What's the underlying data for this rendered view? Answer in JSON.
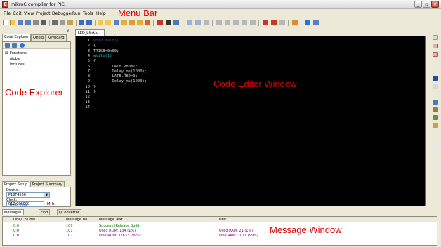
{
  "window": {
    "title": "mikroC compiler for PIC",
    "app_icon_letter": "C",
    "minimize": "_",
    "maximize": "▫",
    "close": "×"
  },
  "menu": {
    "items": [
      "File",
      "Edit",
      "View",
      "Project",
      "Debugger",
      "Run",
      "Tools",
      "Help"
    ]
  },
  "left_panel": {
    "close_glyph": "×",
    "tabs": [
      "Code Explorer",
      "QHelp",
      "Keyboard"
    ],
    "tree": {
      "root": "Functions",
      "root_expander": "⊞",
      "children": [
        "global",
        "includes"
      ]
    }
  },
  "project_setup": {
    "tabs": [
      "Project Setup",
      "Project Summary"
    ],
    "device_label": "Device:",
    "device_value": "P18F4550",
    "clock_label": "Clock:",
    "clock_value": "012.000000",
    "clock_unit": "MHz",
    "build_type": "Build Type"
  },
  "editor": {
    "tab_label": "LED_blink.c",
    "line_numbers": [
      "1",
      "2",
      "3",
      "4",
      "5",
      "6",
      "7",
      "8",
      "9",
      "10",
      "11",
      "12",
      "13",
      "14"
    ],
    "lines": [
      {
        "text": "void main()",
        "color": "#2a4fa8"
      },
      {
        "text": "{",
        "color": "#d0d0d0"
      },
      {
        "text": "TRISB=0x00;",
        "color": "#d0d0d0"
      },
      {
        "text": "while(1)",
        "color": "#2ab0b0"
      },
      {
        "text": "{",
        "color": "#d0d0d0"
      },
      {
        "text": "        LATB.RB0=1;",
        "color": "#d0d0d0"
      },
      {
        "text": "        Delay_ms(1000);",
        "color": "#d0d0d0"
      },
      {
        "text": "        LATB.RB0=0;",
        "color": "#d0d0d0"
      },
      {
        "text": "        Delay_ms(1000);",
        "color": "#d0d0d0"
      },
      {
        "text": "}",
        "color": "#d0d0d0"
      },
      {
        "text": "}",
        "color": "#d0d0d0"
      },
      {
        "text": "",
        "color": "#d0d0d0"
      },
      {
        "text": "",
        "color": "#d0d0d0"
      },
      {
        "text": "",
        "color": "#d0d0d0"
      }
    ]
  },
  "messages": {
    "tabs": [
      "Messages",
      "Find",
      "QConvertor"
    ],
    "columns": [
      "Line/Column",
      "Message No.",
      "Message Text",
      "Unit"
    ],
    "rows": [
      {
        "line": "0:0",
        "no": "100",
        "text": "Success (Release Build)",
        "unit": "",
        "color": "#008000"
      },
      {
        "line": "0:0",
        "no": "101",
        "text": "Used ROM: 134  (1%)",
        "unit": "Used RAM: 21  (1%)",
        "color": "#800080"
      },
      {
        "line": "0:0",
        "no": "102",
        "text": "Free ROM: 32633  (99%)",
        "unit": "Free RAM: 2011  (99%)",
        "color": "#800080"
      }
    ]
  },
  "annotations": {
    "menu_bar": "Menu Bar",
    "code_explorer": "Code Explorer",
    "code_editor": "Code Editor Window",
    "message_window": "Message Window"
  },
  "colors": {
    "annotation": "#e00000",
    "editor_bg": "#000000",
    "chrome": "#ece9d8"
  }
}
